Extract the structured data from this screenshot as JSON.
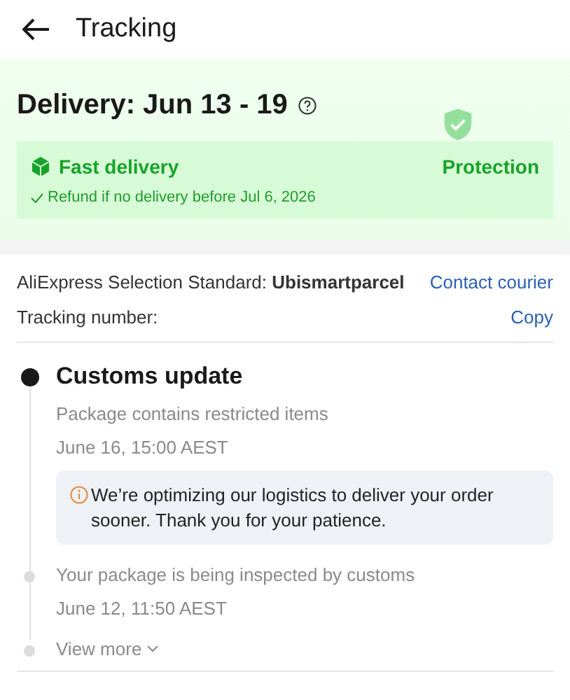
{
  "header": {
    "title": "Tracking"
  },
  "delivery": {
    "heading": "Delivery: Jun 13 - 19",
    "badge": "Fast delivery",
    "protection": "Protection",
    "refund": "Refund if no delivery before Jul 6, 2026"
  },
  "carrier": {
    "label": "AliExpress Selection Standard: **Ubismartparcel**",
    "action": "Contact courier"
  },
  "tracking": {
    "label": "Tracking number:",
    "action": "Copy"
  },
  "events": [
    {
      "kind": "current",
      "title": "Customs update",
      "description": "Package contains restricted items",
      "time": "June 16, 15:00 AEST",
      "notice": "We’re optimizing our logistics to deliver your order sooner. Thank you for your patience."
    },
    {
      "kind": "past",
      "description": "Your package is being inspected by customs",
      "time": "June 12, 11:50 AEST"
    }
  ],
  "view_more": "View more"
}
